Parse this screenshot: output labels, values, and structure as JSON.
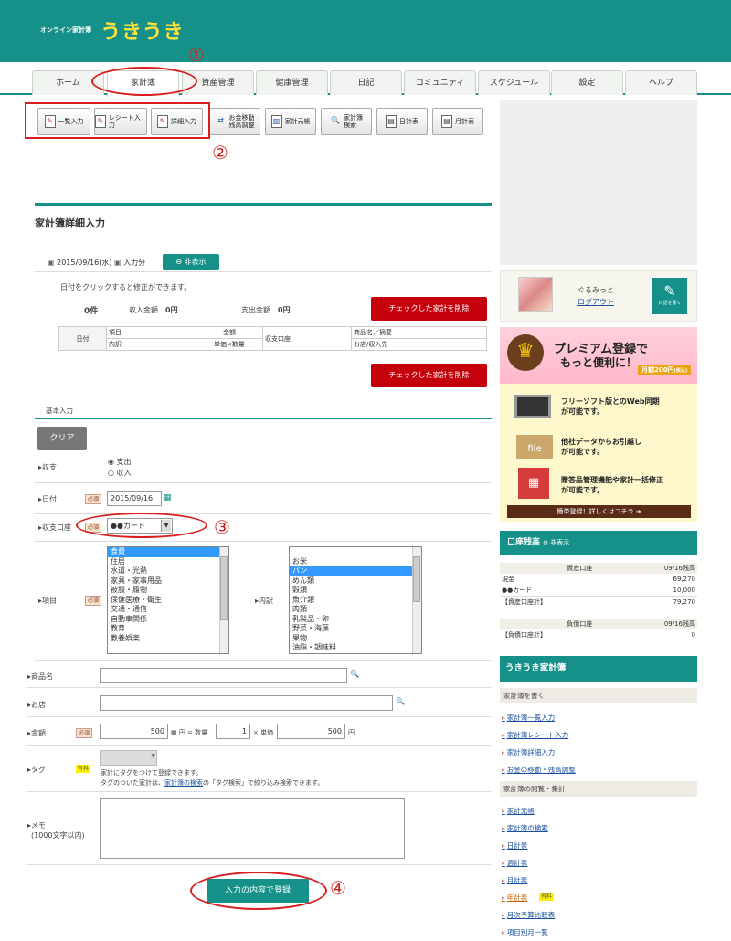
{
  "header": {
    "logo_small": "オンライン家計簿",
    "logo_big": "うきうき"
  },
  "tabs": [
    "ホーム",
    "家計簿",
    "資産管理",
    "健康管理",
    "日記",
    "コミュニティ",
    "スケジュール",
    "設定",
    "ヘルプ"
  ],
  "toolbar": {
    "list": "一覧入力",
    "receipt": "レシート入力",
    "detail": "詳細入力",
    "move_line1": "お金移動",
    "move_line2": "残高調整",
    "ledger": "家計元帳",
    "search_line1": "家計簿",
    "search_line2": "検索",
    "daily": "日計表",
    "monthly": "月計表"
  },
  "callouts": [
    "①",
    "②",
    "③",
    "④"
  ],
  "page_title": "家計簿詳細入力",
  "date_bar": {
    "date": "2015/09/16(水)",
    "suffix": "入力分",
    "hide": "非表示"
  },
  "notice": "日付をクリックすると修正ができます。",
  "summary": {
    "count": "0件",
    "income_label": "収入金額",
    "income": "0円",
    "expense_label": "支出金額",
    "expense": "0円"
  },
  "delete_btn": "チェックした家計を削除",
  "table": {
    "date": "日付",
    "item": "項目",
    "detail": "内訳",
    "amount": "金額",
    "unit": "単価×数量",
    "account": "収支口座",
    "product": "商品名／摘要",
    "shop": "お店/収入先"
  },
  "form": {
    "section": "基本入力",
    "clear": "クリア",
    "kind_label": "収支",
    "kind_expense": "支出",
    "kind_income": "収入",
    "date_label": "日付",
    "required": "必須",
    "date_value": "2015/09/16",
    "account_label": "収支口座",
    "account_value": "●●カード",
    "item_label": "項目",
    "detail_label": "内訳",
    "items": [
      "食費",
      "住居",
      "水道・光熱",
      "家具・家事用品",
      "被服・履物",
      "保健医療・衛生",
      "交通・通信",
      "自動車関係",
      "教育",
      "教養娯楽"
    ],
    "details": [
      "",
      "お米",
      "パン",
      "めん類",
      "穀類",
      "魚介類",
      "肉類",
      "乳製品・卵",
      "野菜・海藻",
      "果物",
      "油脂・調味料"
    ],
    "product_label": "商品名",
    "shop_label": "お店",
    "amount_label": "金額",
    "amount": "500",
    "eq": "円 = 数量",
    "qty": "1",
    "times": "× 単価",
    "price": "500",
    "yen": "円",
    "tag_label": "タグ",
    "paid": "有料",
    "tag_note1": "家計にタグをつけて登録できます。",
    "tag_note2_a": "タグのついた家計は、",
    "tag_note2_link": "家計簿の検索",
    "tag_note2_b": "の「タグ検索」で絞り込み検索できます。",
    "memo_label": "メモ",
    "memo_note": "(1000文字以内)",
    "submit": "入力の内容で登録"
  },
  "user": {
    "name": "ぐるみっと",
    "logout": "ログアウト",
    "diary": "日記を書く"
  },
  "premium": {
    "title1": "プレミアム登録で",
    "title2": "もっと便利に！",
    "price": "月額200円",
    "price_note": "(税込)",
    "f1a": "フリーソフト版とのWeb同期",
    "f1b": "が可能です。",
    "f2a": "他社データからお引越し",
    "f2b": "が可能です。",
    "f3a": "贈答品管理機能や家計一括修正",
    "f3b": "が可能です。",
    "file": "file",
    "cta": "簡単登録！詳しくはコチラ"
  },
  "balance": {
    "title": "口座残高",
    "hide": "非表示",
    "asset_head": "資産口座",
    "date_head": "09/16残高",
    "cash": "現金",
    "cash_v": "69,270",
    "card": "●●カード",
    "card_v": "10,000",
    "asset_total": "【資産口座計】",
    "asset_total_v": "79,270",
    "debt_head": "負債口座",
    "debt_total": "【負債口座計】",
    "debt_total_v": "0"
  },
  "menu": {
    "title": "うきうき家計簿",
    "cat1": "家計簿を書く",
    "l1": [
      "家計簿一覧入力",
      "家計簿レシート入力",
      "家計簿詳細入力",
      "お金の移動・残高調整"
    ],
    "cat2": "家計簿の閲覧・集計",
    "l2": [
      "家計元帳",
      "家計簿の検索",
      "日計表",
      "週計表",
      "月計表",
      "年計表",
      "月次予算比較表",
      "項目別月一覧"
    ],
    "paid": "有料"
  }
}
